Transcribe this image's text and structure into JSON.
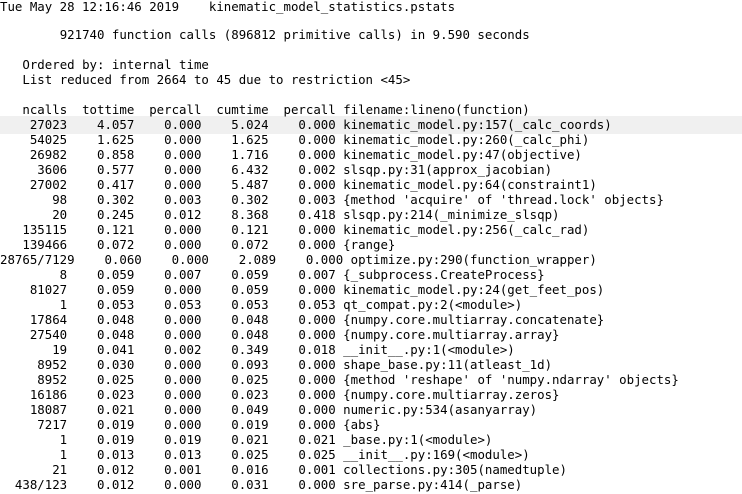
{
  "header": {
    "date": "Tue May 28 12:16:46 2019",
    "filename": "kinematic_model_statistics.pstats"
  },
  "summary": {
    "function_calls": "921740 function calls (896812 primitive calls) in 9.590 seconds",
    "ordered_by": "Ordered by: internal time",
    "list_reduced": "List reduced from 2664 to 45 due to restriction <45>"
  },
  "columns": [
    "ncalls",
    "tottime",
    "percall",
    "cumtime",
    "percall",
    "filename:lineno(function)"
  ],
  "rows": [
    {
      "ncalls": "27023",
      "tottime": "4.057",
      "percall1": "0.000",
      "cumtime": "5.024",
      "percall2": "0.000",
      "func": "kinematic_model.py:157(_calc_coords)"
    },
    {
      "ncalls": "54025",
      "tottime": "1.625",
      "percall1": "0.000",
      "cumtime": "1.625",
      "percall2": "0.000",
      "func": "kinematic_model.py:260(_calc_phi)"
    },
    {
      "ncalls": "26982",
      "tottime": "0.858",
      "percall1": "0.000",
      "cumtime": "1.716",
      "percall2": "0.000",
      "func": "kinematic_model.py:47(objective)"
    },
    {
      "ncalls": "3606",
      "tottime": "0.577",
      "percall1": "0.000",
      "cumtime": "6.432",
      "percall2": "0.002",
      "func": "slsqp.py:31(approx_jacobian)"
    },
    {
      "ncalls": "27002",
      "tottime": "0.417",
      "percall1": "0.000",
      "cumtime": "5.487",
      "percall2": "0.000",
      "func": "kinematic_model.py:64(constraint1)"
    },
    {
      "ncalls": "98",
      "tottime": "0.302",
      "percall1": "0.003",
      "cumtime": "0.302",
      "percall2": "0.003",
      "func": "{method 'acquire' of 'thread.lock' objects}"
    },
    {
      "ncalls": "20",
      "tottime": "0.245",
      "percall1": "0.012",
      "cumtime": "8.368",
      "percall2": "0.418",
      "func": "slsqp.py:214(_minimize_slsqp)"
    },
    {
      "ncalls": "135115",
      "tottime": "0.121",
      "percall1": "0.000",
      "cumtime": "0.121",
      "percall2": "0.000",
      "func": "kinematic_model.py:256(_calc_rad)"
    },
    {
      "ncalls": "139466",
      "tottime": "0.072",
      "percall1": "0.000",
      "cumtime": "0.072",
      "percall2": "0.000",
      "func": "{range}"
    },
    {
      "ncalls": "28765/7129",
      "tottime": "0.060",
      "percall1": "0.000",
      "cumtime": "2.089",
      "percall2": "0.000",
      "func": "optimize.py:290(function_wrapper)"
    },
    {
      "ncalls": "8",
      "tottime": "0.059",
      "percall1": "0.007",
      "cumtime": "0.059",
      "percall2": "0.007",
      "func": "{_subprocess.CreateProcess}"
    },
    {
      "ncalls": "81027",
      "tottime": "0.059",
      "percall1": "0.000",
      "cumtime": "0.059",
      "percall2": "0.000",
      "func": "kinematic_model.py:24(get_feet_pos)"
    },
    {
      "ncalls": "1",
      "tottime": "0.053",
      "percall1": "0.053",
      "cumtime": "0.053",
      "percall2": "0.053",
      "func": "qt_compat.py:2(<module>)"
    },
    {
      "ncalls": "17864",
      "tottime": "0.048",
      "percall1": "0.000",
      "cumtime": "0.048",
      "percall2": "0.000",
      "func": "{numpy.core.multiarray.concatenate}"
    },
    {
      "ncalls": "27540",
      "tottime": "0.048",
      "percall1": "0.000",
      "cumtime": "0.048",
      "percall2": "0.000",
      "func": "{numpy.core.multiarray.array}"
    },
    {
      "ncalls": "19",
      "tottime": "0.041",
      "percall1": "0.002",
      "cumtime": "0.349",
      "percall2": "0.018",
      "func": "__init__.py:1(<module>)"
    },
    {
      "ncalls": "8952",
      "tottime": "0.030",
      "percall1": "0.000",
      "cumtime": "0.093",
      "percall2": "0.000",
      "func": "shape_base.py:11(atleast_1d)"
    },
    {
      "ncalls": "8952",
      "tottime": "0.025",
      "percall1": "0.000",
      "cumtime": "0.025",
      "percall2": "0.000",
      "func": "{method 'reshape' of 'numpy.ndarray' objects}"
    },
    {
      "ncalls": "16186",
      "tottime": "0.023",
      "percall1": "0.000",
      "cumtime": "0.023",
      "percall2": "0.000",
      "func": "{numpy.core.multiarray.zeros}"
    },
    {
      "ncalls": "18087",
      "tottime": "0.021",
      "percall1": "0.000",
      "cumtime": "0.049",
      "percall2": "0.000",
      "func": "numeric.py:534(asanyarray)"
    },
    {
      "ncalls": "7217",
      "tottime": "0.019",
      "percall1": "0.000",
      "cumtime": "0.019",
      "percall2": "0.000",
      "func": "{abs}"
    },
    {
      "ncalls": "1",
      "tottime": "0.019",
      "percall1": "0.019",
      "cumtime": "0.021",
      "percall2": "0.021",
      "func": "_base.py:1(<module>)"
    },
    {
      "ncalls": "1",
      "tottime": "0.013",
      "percall1": "0.013",
      "cumtime": "0.025",
      "percall2": "0.025",
      "func": "__init__.py:169(<module>)"
    },
    {
      "ncalls": "21",
      "tottime": "0.012",
      "percall1": "0.001",
      "cumtime": "0.016",
      "percall2": "0.001",
      "func": "collections.py:305(namedtuple)"
    },
    {
      "ncalls": "438/123",
      "tottime": "0.012",
      "percall1": "0.000",
      "cumtime": "0.031",
      "percall2": "0.000",
      "func": "sre_parse.py:414(_parse)"
    }
  ]
}
